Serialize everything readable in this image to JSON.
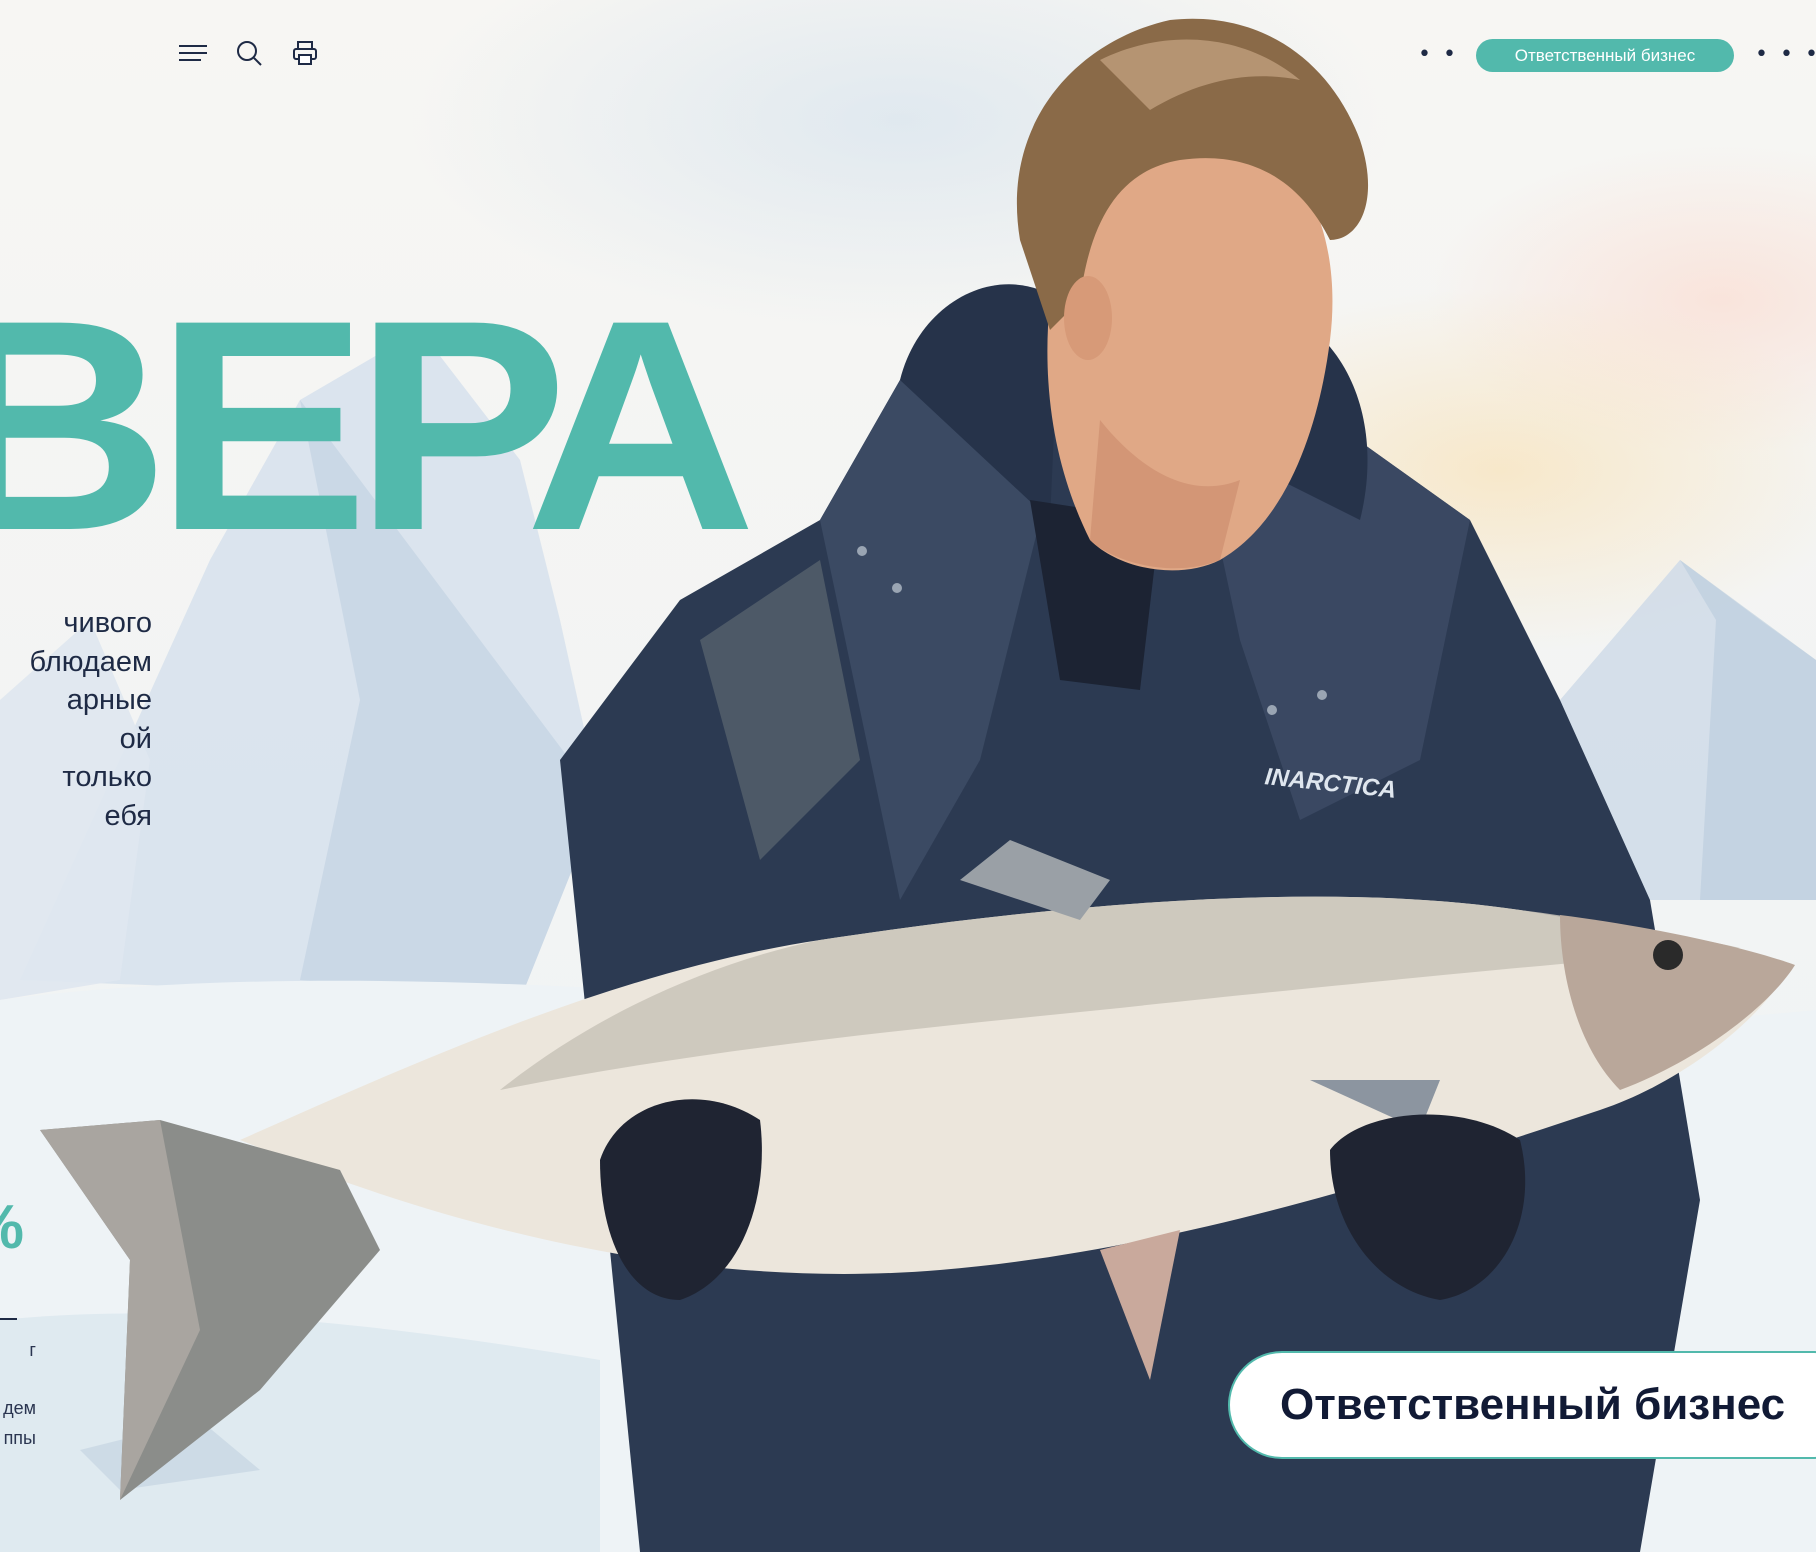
{
  "header": {
    "icons": [
      "menu-icon",
      "search-icon",
      "print-icon"
    ],
    "nav_label": "Ответственный бизнес"
  },
  "hero": {
    "headline": "ВЕРА",
    "intro_lines": [
      "чивого",
      "блюдаем",
      "арные",
      "ой",
      " только",
      "ебя"
    ],
    "logo_text": "INARCTICA"
  },
  "stat": {
    "value": "%",
    "lines": [
      "г",
      "дем",
      "ппы"
    ]
  },
  "section": {
    "title": "Ответственный бизнес"
  },
  "colors": {
    "accent": "#52b9ac",
    "text_dark": "#1e2a45"
  }
}
